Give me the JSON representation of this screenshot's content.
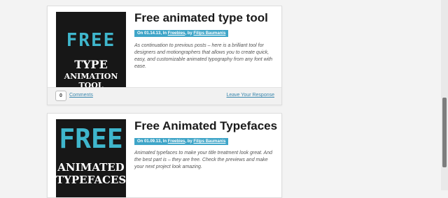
{
  "posts": [
    {
      "title": "Free animated type tool",
      "meta_prefix": "On 01.14.13, In ",
      "category": "Freebies",
      "meta_by": ", by ",
      "author": "Filips Baumanis",
      "excerpt": "As continuation to previous posts – here is a brilliant tool for designers and motiongraphers that allows you to create quick, easy, and customizable animated typography from any font with ease.",
      "thumb_big": "FREE",
      "thumb_line1": "TYPE",
      "thumb_line2": "ANIMATION TOOL",
      "comment_count": "0",
      "comments_label": "Comments",
      "leave_label": "Leave Your Response"
    },
    {
      "title": "Free Animated Typefaces",
      "meta_prefix": "On 01.09.13, In ",
      "category": "Freebies",
      "meta_by": ", by ",
      "author": "Filips Baumanis",
      "excerpt": "Animated typefaces to make your title treatment look great. And the best part is – they are free. Check the previews and make your next project look amazing.",
      "thumb_big": "FREE",
      "thumb_line1": "ANIMATED",
      "thumb_line2": "TYPEFACES"
    }
  ],
  "colors": {
    "accent": "#3fa5c8",
    "thumb_accent": "#3fb6cc",
    "link": "#3a87ad"
  },
  "icons": {
    "scrollbar_thumb": "scroll-thumb"
  }
}
